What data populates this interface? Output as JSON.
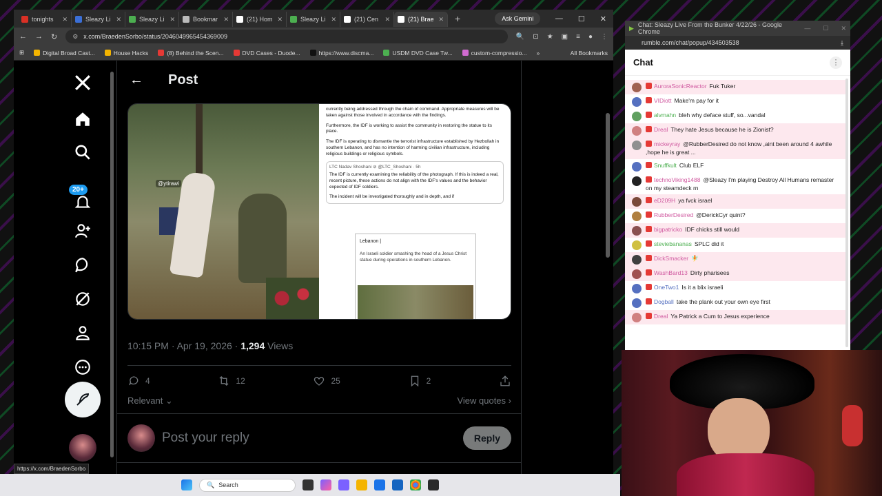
{
  "browser": {
    "tabs": [
      {
        "label": "tonights",
        "color": "#d93025"
      },
      {
        "label": "Sleazy Li",
        "color": "#3b6fd6"
      },
      {
        "label": "Sleazy Li",
        "color": "#4caf50"
      },
      {
        "label": "Bookmar",
        "color": "#bbbbbb"
      },
      {
        "label": "(21) Hom",
        "color": "#ffffff"
      },
      {
        "label": "Sleazy Li",
        "color": "#4caf50"
      },
      {
        "label": "(21) Cen",
        "color": "#ffffff"
      },
      {
        "label": "(21) Brae",
        "color": "#ffffff"
      }
    ],
    "gemini_label": "Ask Gemini",
    "url": "x.com/BraedenSorbo/status/2046049965454369009",
    "bookmarks": [
      {
        "label": "Digital Broad Cast...",
        "color": "#f4b400"
      },
      {
        "label": "House Hacks",
        "color": "#f4b400"
      },
      {
        "label": "(8) Behind the Scen...",
        "color": "#e53935"
      },
      {
        "label": "DVD Cases - Duode...",
        "color": "#e53935"
      },
      {
        "label": "https://www.discma...",
        "color": "#111111"
      },
      {
        "label": "USDM DVD Case Tw...",
        "color": "#4caf50"
      },
      {
        "label": "custom-compressio...",
        "color": "#d06bd0"
      }
    ],
    "bookmarks_all": "All Bookmarks",
    "status_url": "https://x.com/BraedenSorbo"
  },
  "x": {
    "notif_badge": "20+",
    "post_title": "Post",
    "media": {
      "watermark": "@ytirawi",
      "text_p1": "currently being addressed through the chain of command. Appropriate measures will be taken against those involved in accordance with the findings.",
      "text_p2": "Furthermore, the IDF is working to assist the community in restoring the statue to its place.",
      "text_p3": "The IDF is operating to dismantle the terrorist infrastructure established by Hezbollah in southern Lebanon, and has no intention of harming civilian infrastructure, including religious buildings or religious symbols.",
      "quote_who": "LTC Nadav Shoshani ⊘ @LTC_Shoshani · 5h",
      "quote_text": "The IDF is currently examining the reliability of the photograph. If this is indeed a real, recent picture, these actions do not align with the IDF's values and the behavior expected of IDF soldiers.",
      "quote_text2": "The incident will be investigated thoroughly and in depth, and if",
      "card_title": "Lebanon |",
      "card_body": "An Israeli soldier smashing the head of a Jesus Christ statue during operations in southern Lebanon."
    },
    "timestamp": "10:15 PM · Apr 19, 2026 · ",
    "views_count": "1,294",
    "views_label": " Views",
    "actions": {
      "replies": "4",
      "reposts": "12",
      "likes": "25",
      "bookmarks": "2"
    },
    "sort_label": "Relevant",
    "view_quotes": "View quotes",
    "reply_placeholder": "Post your reply",
    "reply_button": "Reply"
  },
  "taskbar": {
    "search_label": "Search"
  },
  "chat": {
    "window_title": "Chat: Sleazy Live From the Bunker 4/22/26 - Google Chrome",
    "url": "rumble.com/chat/popup/434503538",
    "header": "Chat",
    "messages": [
      {
        "user": "AuroraSonicReactor",
        "text": "Fuk Tuker",
        "user_color": "#d05aa0",
        "av": "#a06050",
        "hl": true
      },
      {
        "user": "VIDiott",
        "text": "Make'm pay for it",
        "user_color": "#d05aa0",
        "av": "#5570c0",
        "hl": false
      },
      {
        "user": "alvmahn",
        "text": "bleh why deface stuff, so...vandal",
        "user_color": "#4caf50",
        "av": "#60a060",
        "hl": false
      },
      {
        "user": "Dreal",
        "text": "They hate Jesus because he is Zionist?",
        "user_color": "#d05aa0",
        "av": "#d08080",
        "hl": true
      },
      {
        "user": "mickeyray",
        "text": "@RubberDesired do not know ,aint been around 4 awhile ,hope he is great ...",
        "user_color": "#d05aa0",
        "av": "#909090",
        "hl": true
      },
      {
        "user": "Snuffkult",
        "text": "Club ELF",
        "user_color": "#4caf50",
        "av": "#5570c0",
        "hl": false
      },
      {
        "user": "technoViking1488",
        "text": "@Sleazy I'm playing Destroy All Humans remaster on my steamdeck rn",
        "user_color": "#d05aa0",
        "av": "#222222",
        "hl": false
      },
      {
        "user": "eD209H",
        "text": "ya fvck israel",
        "user_color": "#d05aa0",
        "av": "#7a4a3a",
        "hl": true
      },
      {
        "user": "RubberDesired",
        "text": "@DerickCyr quint?",
        "user_color": "#d05aa0",
        "av": "#b08040",
        "hl": false
      },
      {
        "user": "bigpatricko",
        "text": "IDF chicks still would",
        "user_color": "#d05aa0",
        "av": "#8a5050",
        "hl": true
      },
      {
        "user": "steviebananas",
        "text": "SPLC did it",
        "user_color": "#4caf50",
        "av": "#d0c040",
        "hl": false
      },
      {
        "user": "DickSmacker",
        "text": "🧚",
        "user_color": "#d05aa0",
        "av": "#404040",
        "hl": true
      },
      {
        "user": "WashBard13",
        "text": "Dirty pharisees",
        "user_color": "#d05aa0",
        "av": "#a05050",
        "hl": true
      },
      {
        "user": "OneTwo1",
        "text": "Is it a blix israeli",
        "user_color": "#5570c0",
        "av": "#5570c0",
        "hl": false
      },
      {
        "user": "Dogball",
        "text": "take the plank out your own eye first",
        "user_color": "#5570c0",
        "av": "#5570c0",
        "hl": false
      },
      {
        "user": "Dreal",
        "text": "Ya Patrick a Cum to Jesus experience",
        "user_color": "#d05aa0",
        "av": "#d08080",
        "hl": true
      }
    ]
  }
}
